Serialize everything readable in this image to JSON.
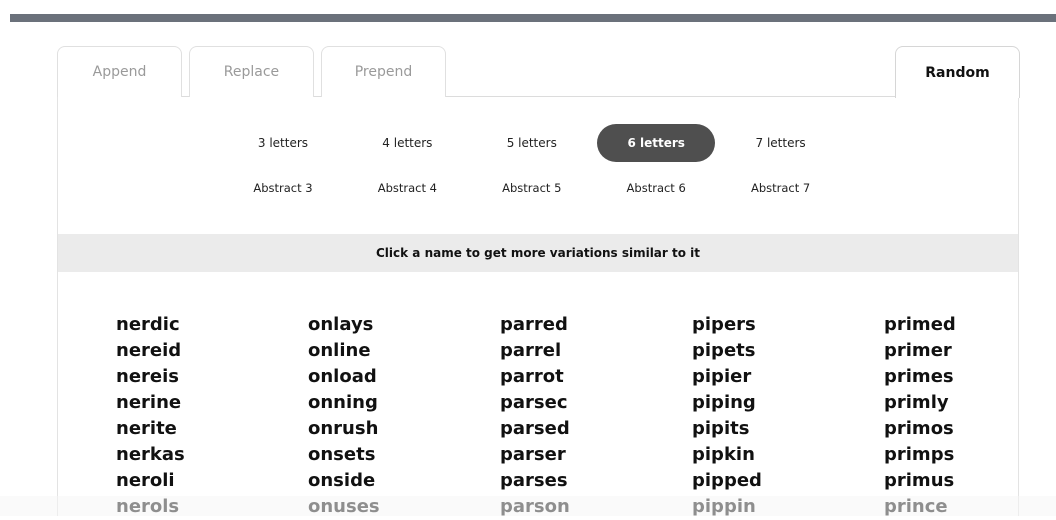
{
  "tabs": [
    {
      "label": "Append"
    },
    {
      "label": "Replace"
    },
    {
      "label": "Prepend"
    },
    {
      "label": "Random"
    }
  ],
  "letter_options": [
    "3 letters",
    "4 letters",
    "5 letters",
    "6 letters",
    "7 letters"
  ],
  "abstract_options": [
    "Abstract 3",
    "Abstract 4",
    "Abstract 5",
    "Abstract 6",
    "Abstract 7"
  ],
  "active_tab": "Random",
  "active_letters": "6 letters",
  "info": "Click a name to get more variations similar to it",
  "columns": [
    [
      "nerdic",
      "nereid",
      "nereis",
      "nerine",
      "nerite",
      "nerkas",
      "neroli",
      "nerols"
    ],
    [
      "onlays",
      "online",
      "onload",
      "onning",
      "onrush",
      "onsets",
      "onside",
      "onuses"
    ],
    [
      "parred",
      "parrel",
      "parrot",
      "parsec",
      "parsed",
      "parser",
      "parses",
      "parson"
    ],
    [
      "pipers",
      "pipets",
      "pipier",
      "piping",
      "pipits",
      "pipkin",
      "pipped",
      "pippin"
    ],
    [
      "primed",
      "primer",
      "primes",
      "primly",
      "primos",
      "primps",
      "primus",
      "prince"
    ]
  ],
  "colors": {
    "topbar": "#6b717b",
    "active_pill": "#4f4f4f",
    "info_bar": "#ebebeb"
  }
}
